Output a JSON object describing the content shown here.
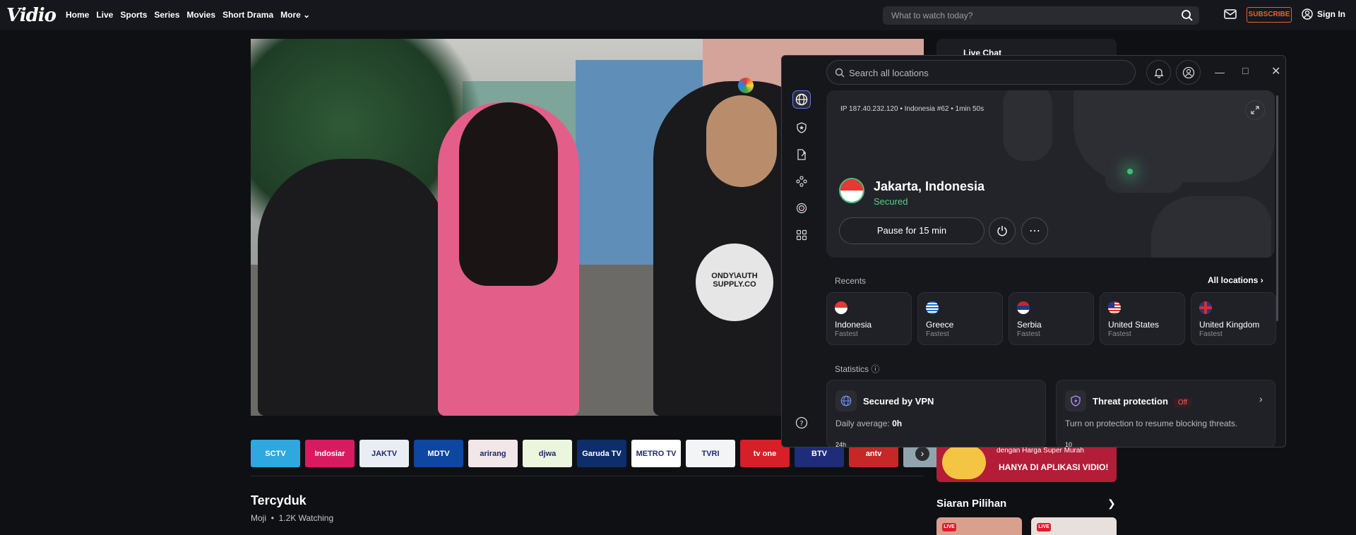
{
  "header": {
    "logo_text": "Vidio",
    "nav": [
      "Home",
      "Live",
      "Sports",
      "Series",
      "Movies",
      "Short Drama",
      "More"
    ],
    "search_placeholder": "What to watch today?",
    "subscribe_label": "SUBSCRIBE",
    "signin_label": "Sign In"
  },
  "player": {
    "shirt_print": "ONDY\\AUTH SUPPLY.CO"
  },
  "channels": [
    {
      "label": "SCTV",
      "color": "#2fa8e0"
    },
    {
      "label": "Indosiar",
      "color": "#d81b60"
    },
    {
      "label": "JAKTV",
      "color": "#e9eef5"
    },
    {
      "label": "MDTV",
      "color": "#0d47a1"
    },
    {
      "label": "arirang",
      "color": "#f3e6e9"
    },
    {
      "label": "djwa",
      "color": "#ecf5de"
    },
    {
      "label": "Garuda TV",
      "color": "#0e2d6b"
    },
    {
      "label": "METRO TV",
      "color": "#ffffff"
    },
    {
      "label": "TVRI",
      "color": "#f3f4f6"
    },
    {
      "label": "tv one",
      "color": "#d61f26"
    },
    {
      "label": "BTV",
      "color": "#1f2c7a"
    },
    {
      "label": "antv",
      "color": "#c62828"
    },
    {
      "label": "",
      "color": "#90a4ae"
    }
  ],
  "video": {
    "title": "Tercyduk",
    "channel": "Moji",
    "watching": "1.2K Watching"
  },
  "sidebar": {
    "live_chat_label": "Live Chat",
    "promo_line1": "dengan Harga Super Murah",
    "promo_line2": "HANYA DI APLIKASI VIDIO!",
    "siaran_title": "Siaran Pilihan",
    "live_badge": "LIVE"
  },
  "vpn": {
    "search_placeholder": "Search all locations",
    "ip_line": "IP 187.40.232.120 • Indonesia #62 • 1min 50s",
    "location": "Jakarta, Indonesia",
    "status": "Secured",
    "pause_label": "Pause for 15 min",
    "recents_label": "Recents",
    "all_locations_label": "All locations",
    "recents": [
      {
        "name": "Indonesia",
        "sub": "Fastest"
      },
      {
        "name": "Greece",
        "sub": "Fastest"
      },
      {
        "name": "Serbia",
        "sub": "Fastest"
      },
      {
        "name": "United States",
        "sub": "Fastest"
      },
      {
        "name": "United Kingdom",
        "sub": "Fastest"
      }
    ],
    "statistics_label": "Statistics",
    "vpn_card": {
      "title": "Secured by VPN",
      "text_prefix": "Daily average:",
      "value": "0h",
      "tick": "24h"
    },
    "threat_card": {
      "title": "Threat protection",
      "status": "Off",
      "text": "Turn on protection to resume blocking threats.",
      "tick": "10"
    },
    "colors": {
      "secured": "#4fd28a",
      "accent": "#5b7cf5"
    }
  }
}
